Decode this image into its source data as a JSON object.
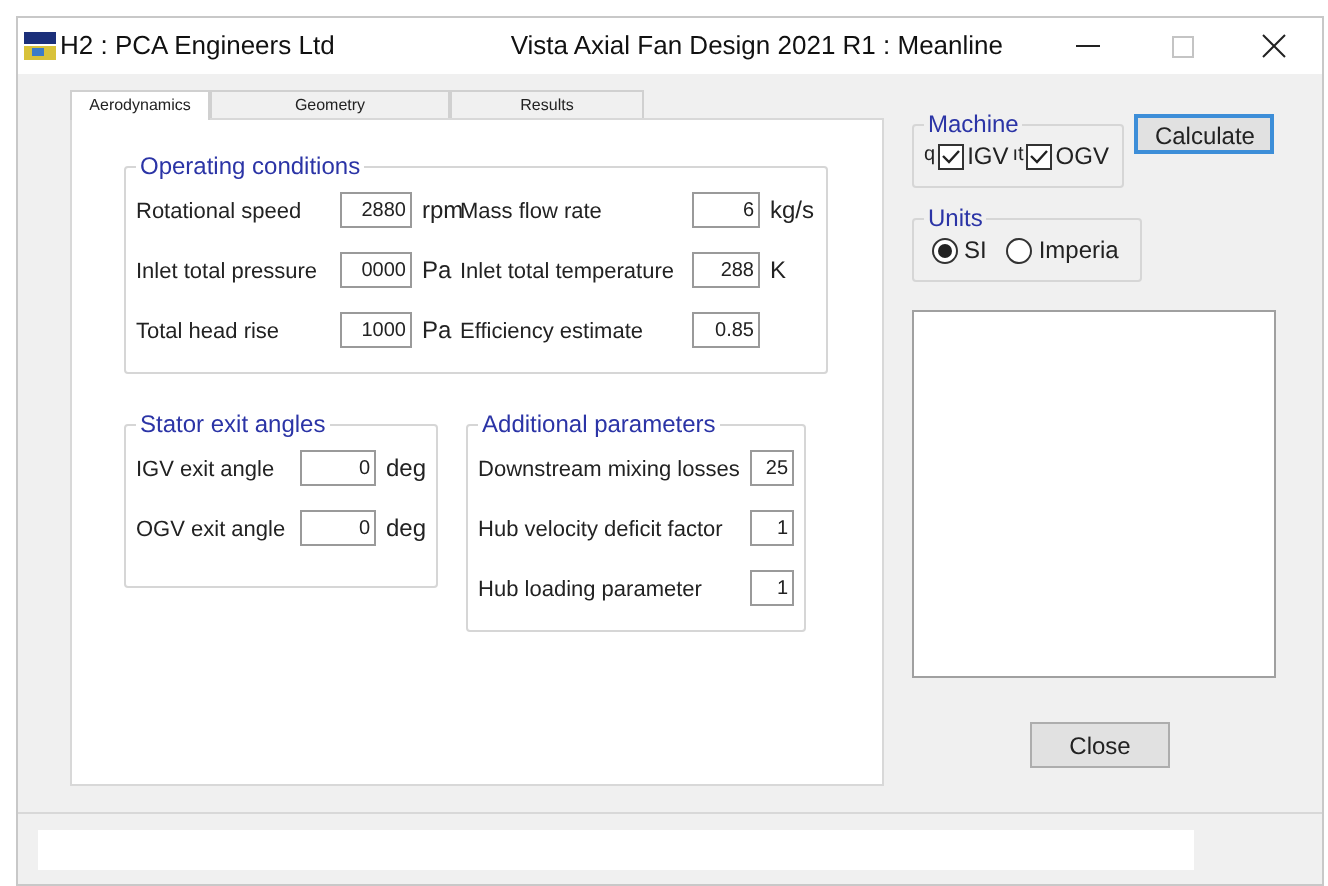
{
  "window": {
    "app_title": "H2 : PCA Engineers Ltd",
    "title": "Vista Axial Fan Design 2021 R1 : Meanline"
  },
  "tabs": [
    {
      "label": "Aerodynamics",
      "selected": true
    },
    {
      "label": "Geometry",
      "selected": false
    },
    {
      "label": "Results",
      "selected": false
    }
  ],
  "operating_conditions": {
    "title": "Operating conditions",
    "fields": [
      {
        "label": "Rotational speed",
        "value": "2880",
        "unit": "rpm"
      },
      {
        "label": "Mass flow rate",
        "value": "6",
        "unit": "kg/s"
      },
      {
        "label": "Inlet total pressure",
        "value": "0000",
        "unit": "Pa"
      },
      {
        "label": "Inlet total temperature",
        "value": "288",
        "unit": "K"
      },
      {
        "label": "Total head rise",
        "value": "1000",
        "unit": "Pa"
      },
      {
        "label": "Efficiency estimate",
        "value": "0.85"
      }
    ]
  },
  "stator_exit_angles": {
    "title": "Stator exit angles",
    "fields": [
      {
        "label": "IGV exit angle",
        "value": "0",
        "unit": "deg"
      },
      {
        "label": "OGV exit angle",
        "value": "0",
        "unit": "deg"
      }
    ]
  },
  "additional_parameters": {
    "title": "Additional parameters",
    "fields": [
      {
        "label": "Downstream mixing losses",
        "value": "25"
      },
      {
        "label": "Hub velocity deficit factor",
        "value": "1"
      },
      {
        "label": "Hub loading parameter",
        "value": "1"
      }
    ]
  },
  "machine": {
    "title": "Machine",
    "options": [
      {
        "clipped_label": "q",
        "label": "IGV",
        "checked": true
      },
      {
        "clipped_label": "ıt",
        "label": "OGV",
        "checked": true
      }
    ]
  },
  "calculate_button": "Calculate",
  "units": {
    "title": "Units",
    "options": [
      {
        "label": "SI",
        "selected": true
      },
      {
        "label": "Imperia",
        "selected": false
      }
    ]
  },
  "close_button": "Close"
}
